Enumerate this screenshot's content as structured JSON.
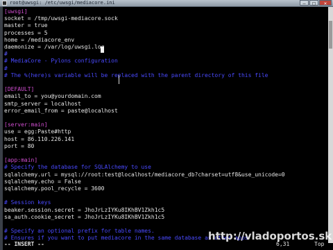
{
  "window": {
    "title": "root@uwsgi: /etc/uwsgi/mediacore.ini",
    "buttons": [
      "–",
      "□",
      "✕"
    ]
  },
  "editor": {
    "lines": [
      {
        "type": "sec",
        "text": "[uwsgi]"
      },
      {
        "type": "val",
        "text": "socket = /tmp/uwsgi-mediacore.sock"
      },
      {
        "type": "val",
        "text": "master = true"
      },
      {
        "type": "val",
        "text": "processes = 5"
      },
      {
        "type": "val",
        "text": "home = /mediacore_env"
      },
      {
        "type": "val",
        "text": "daemonize = /var/log/uwsgi.log"
      },
      {
        "type": "tilde",
        "text": "#"
      },
      {
        "type": "cmt",
        "text": "# MediaCore - Pylons configuration"
      },
      {
        "type": "cmt",
        "text": "#"
      },
      {
        "type": "cmt",
        "text": "# The %(here)s variable will be replaced with the parent directory of this file"
      },
      {
        "type": "tilde",
        "text": ""
      },
      {
        "type": "sec",
        "text": "[DEFAULT]"
      },
      {
        "type": "val",
        "text": "email_to = you@yourdomain.com"
      },
      {
        "type": "val",
        "text": "smtp_server = localhost"
      },
      {
        "type": "val",
        "text": "error_email_from = paste@localhost"
      },
      {
        "type": "tilde",
        "text": ""
      },
      {
        "type": "sec",
        "text": "[server:main]"
      },
      {
        "type": "val",
        "text": "use = egg:Paste#http"
      },
      {
        "type": "val",
        "text": "host = 86.110.226.141"
      },
      {
        "type": "val",
        "text": "port = 80"
      },
      {
        "type": "tilde",
        "text": ""
      },
      {
        "type": "sec",
        "text": "[app:main]"
      },
      {
        "type": "cmt",
        "text": "# Specify the database for SQLAlchemy to use"
      },
      {
        "type": "val",
        "text": "sqlalchemy.url = mysql://root:test@localhost/mediacore_db?charset=utf8&use_unicode=0"
      },
      {
        "type": "val",
        "text": "sqlalchemy.echo = False"
      },
      {
        "type": "val",
        "text": "sqlalchemy.pool_recycle = 3600"
      },
      {
        "type": "tilde",
        "text": ""
      },
      {
        "type": "cmt",
        "text": "# Session keys"
      },
      {
        "type": "val",
        "text": "beaker.session.secret = JhoJrLzIYKu8IKhBV1Zkh1c5"
      },
      {
        "type": "val",
        "text": "sa_auth.cookie_secret = JhoJrLzIYKu8IKhBV1Zkh1c5"
      },
      {
        "type": "tilde",
        "text": ""
      },
      {
        "type": "cmt",
        "text": "# Specify an optional prefix for table names."
      },
      {
        "type": "cmt",
        "text": "# Ensures if you want to put mediacore in the same database as other apps"
      }
    ]
  },
  "status": {
    "mode": "-- INSERT --",
    "position": "6,31",
    "scroll": "Top"
  },
  "watermark": "http://vladoportos.sk"
}
